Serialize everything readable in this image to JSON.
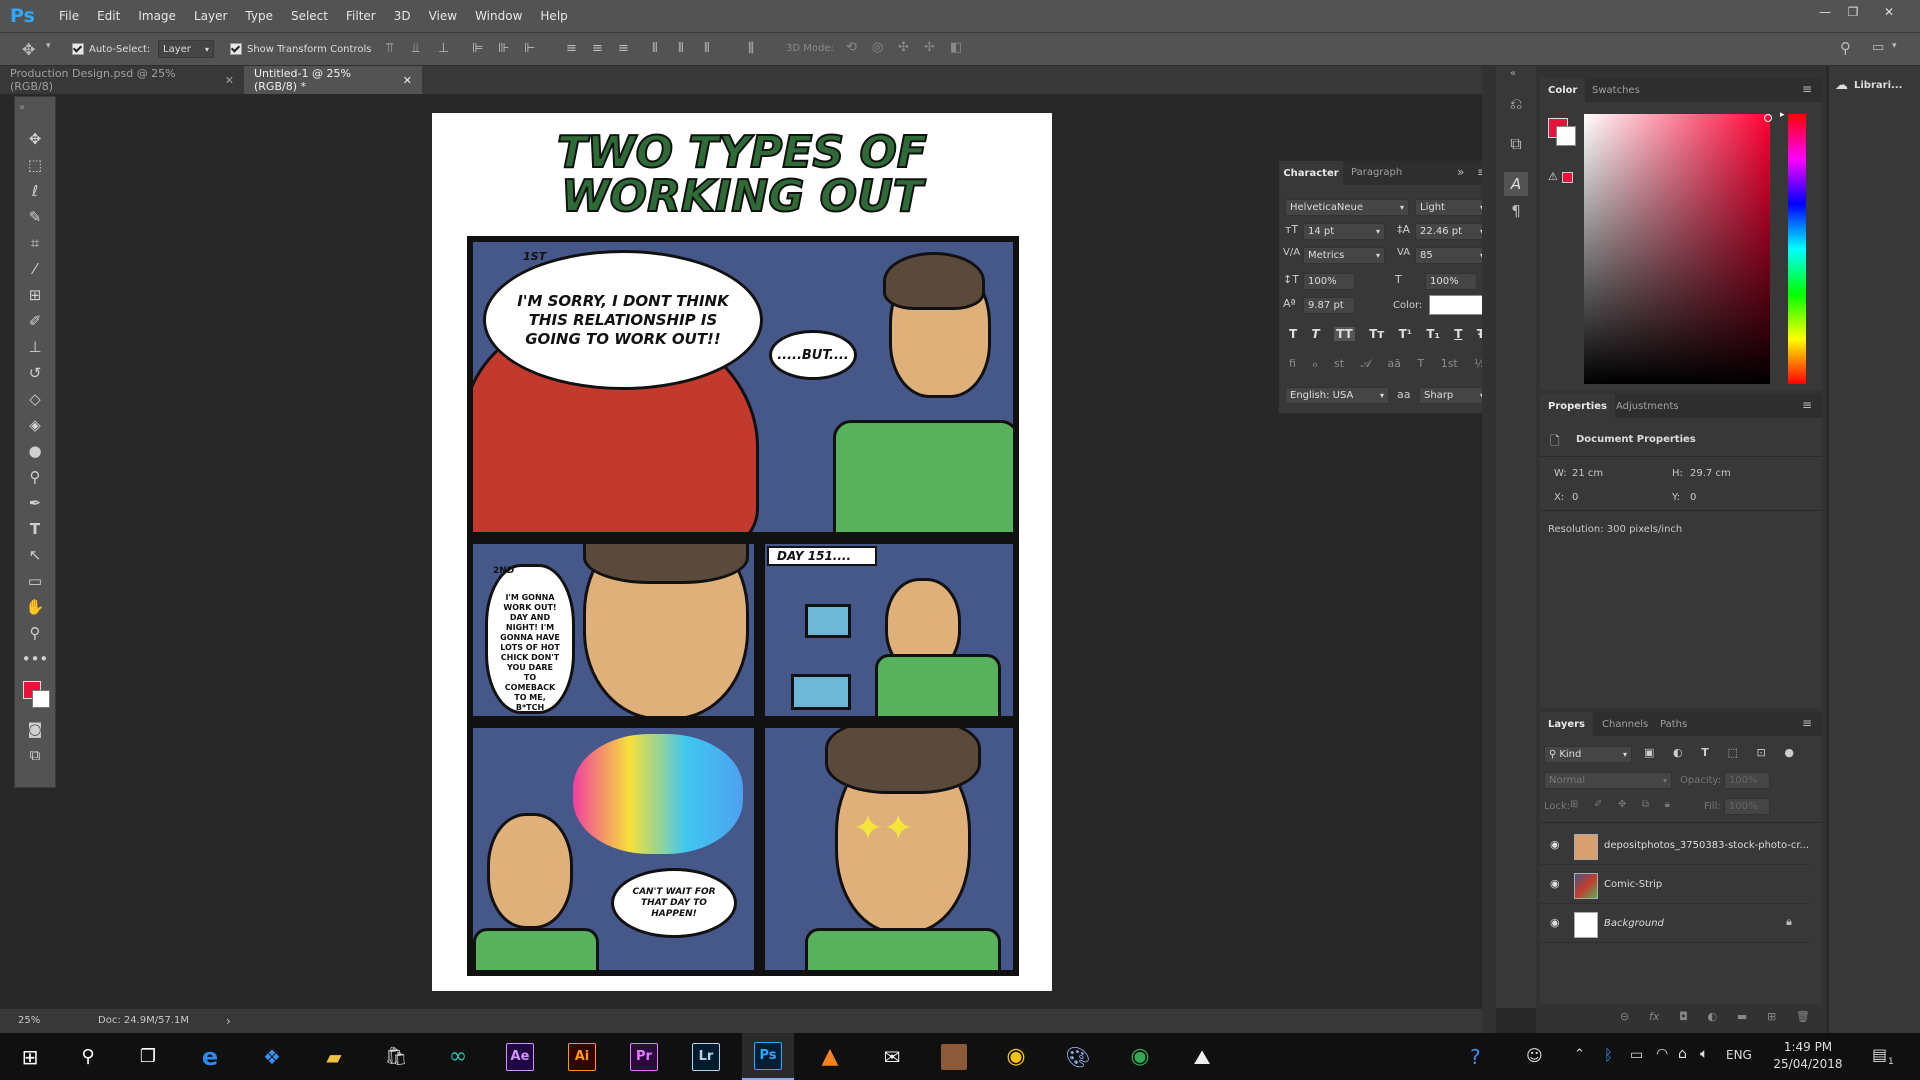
{
  "app": {
    "logo": "Ps"
  },
  "menu": [
    "File",
    "Edit",
    "Image",
    "Layer",
    "Type",
    "Select",
    "Filter",
    "3D",
    "View",
    "Window",
    "Help"
  ],
  "window_controls": {
    "minimize": "—",
    "restore": "❐",
    "close": "✕"
  },
  "options": {
    "auto_select_label": "Auto-Select:",
    "auto_select_target": "Layer",
    "show_transform_label": "Show Transform Controls",
    "mode_3d_label": "3D Mode:"
  },
  "tabs": [
    {
      "label": "Production Design.psd @ 25% (RGB/8)",
      "close": "✕"
    },
    {
      "label": "Untitled-1 @ 25% (RGB/8) *",
      "close": "✕"
    }
  ],
  "status": {
    "zoom": "25%",
    "doc": "Doc: 24.9M/57.1M",
    "arrow": "›"
  },
  "comic": {
    "title_line1": "TWO TYPES OF",
    "title_line2": "WORKING OUT",
    "p1_label": "1ST",
    "p1_speech": "I'M SORRY, I DONT THINK THIS RELATIONSHIP IS GOING TO WORK OUT!!",
    "p1_reply": ".....BUT....",
    "p2_label": "2ND",
    "p2_speech": "I'M GONNA WORK OUT! DAY AND NIGHT! I'M GONNA HAVE LOTS OF HOT CHICK DON'T YOU DARE TO COMEBACK TO ME, B*TCH",
    "p3_caption": "DAY 151....",
    "p4_thought": "CAN'T WAIT FOR THAT DAY TO HAPPEN!"
  },
  "character_panel": {
    "tab_character": "Character",
    "tab_paragraph": "Paragraph",
    "font_family": "HelveticaNeue",
    "font_style": "Light",
    "font_size": "14 pt",
    "leading": "22.46 pt",
    "kerning": "Metrics",
    "tracking": "85",
    "vertical_scale": "100%",
    "horizontal_scale": "100%",
    "baseline_shift": "9.87 pt",
    "color_label": "Color:",
    "text_color": "#ffffff",
    "style_buttons": [
      "T",
      "T",
      "TT",
      "Tт",
      "T¹",
      "T₁",
      "T",
      "Ŧ"
    ],
    "opentype_buttons": [
      "fi",
      "ℴ",
      "st",
      "𝒜",
      "aā",
      "T",
      "1st",
      "½"
    ],
    "language": "English: USA",
    "aa_icon": "aa",
    "antialias": "Sharp"
  },
  "color_panel": {
    "tab_color": "Color",
    "tab_swatches": "Swatches",
    "foreground": "#e8133a",
    "background": "#ffffff"
  },
  "properties_panel": {
    "tab_properties": "Properties",
    "tab_adjustments": "Adjustments",
    "title": "Document Properties",
    "w_label": "W:",
    "w_value": "21 cm",
    "h_label": "H:",
    "h_value": "29.7 cm",
    "x_label": "X:",
    "x_value": "0",
    "y_label": "Y:",
    "y_value": "0",
    "resolution": "Resolution: 300 pixels/inch"
  },
  "layers_panel": {
    "tab_layers": "Layers",
    "tab_channels": "Channels",
    "tab_paths": "Paths",
    "filter_kind": "Kind",
    "blend_mode": "Normal",
    "opacity_label": "Opacity:",
    "opacity_value": "100%",
    "lock_label": "Lock:",
    "fill_label": "Fill:",
    "fill_value": "100%",
    "layers": [
      {
        "name": "depositphotos_3750383-stock-photo-cr..."
      },
      {
        "name": "Comic-Strip"
      },
      {
        "name": "Background"
      }
    ]
  },
  "libraries": {
    "label": "Librari..."
  },
  "taskbar": {
    "apps": [
      "Ae",
      "Ai",
      "Pr",
      "Lr",
      "Ps"
    ],
    "language": "ENG",
    "time": "1:49 PM",
    "date": "25/04/2018",
    "notif_count": "1"
  }
}
